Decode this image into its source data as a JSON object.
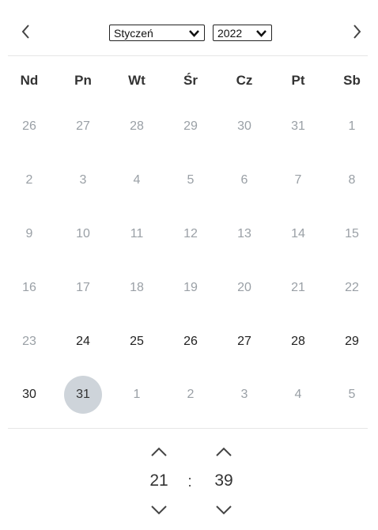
{
  "header": {
    "prev_icon": "chevron-left-icon",
    "next_icon": "chevron-right-icon",
    "month": "Styczeń",
    "year": "2022"
  },
  "weekdays": [
    "Nd",
    "Pn",
    "Wt",
    "Śr",
    "Cz",
    "Pt",
    "Sb"
  ],
  "weeks": [
    [
      {
        "d": "26",
        "m": true
      },
      {
        "d": "27",
        "m": true
      },
      {
        "d": "28",
        "m": true
      },
      {
        "d": "29",
        "m": true
      },
      {
        "d": "30",
        "m": true
      },
      {
        "d": "31",
        "m": true
      },
      {
        "d": "1",
        "m": true
      }
    ],
    [
      {
        "d": "2",
        "m": true
      },
      {
        "d": "3",
        "m": true
      },
      {
        "d": "4",
        "m": true
      },
      {
        "d": "5",
        "m": true
      },
      {
        "d": "6",
        "m": true
      },
      {
        "d": "7",
        "m": true
      },
      {
        "d": "8",
        "m": true
      }
    ],
    [
      {
        "d": "9",
        "m": true
      },
      {
        "d": "10",
        "m": true
      },
      {
        "d": "11",
        "m": true
      },
      {
        "d": "12",
        "m": true
      },
      {
        "d": "13",
        "m": true
      },
      {
        "d": "14",
        "m": true
      },
      {
        "d": "15",
        "m": true
      }
    ],
    [
      {
        "d": "16",
        "m": true
      },
      {
        "d": "17",
        "m": true
      },
      {
        "d": "18",
        "m": true
      },
      {
        "d": "19",
        "m": true
      },
      {
        "d": "20",
        "m": true
      },
      {
        "d": "21",
        "m": true
      },
      {
        "d": "22",
        "m": true
      }
    ],
    [
      {
        "d": "23",
        "m": true
      },
      {
        "d": "24",
        "m": false
      },
      {
        "d": "25",
        "m": false
      },
      {
        "d": "26",
        "m": false
      },
      {
        "d": "27",
        "m": false
      },
      {
        "d": "28",
        "m": false
      },
      {
        "d": "29",
        "m": false
      }
    ],
    [
      {
        "d": "30",
        "m": false
      },
      {
        "d": "31",
        "m": false,
        "selected": true
      },
      {
        "d": "1",
        "m": true
      },
      {
        "d": "2",
        "m": true
      },
      {
        "d": "3",
        "m": true
      },
      {
        "d": "4",
        "m": true
      },
      {
        "d": "5",
        "m": true
      }
    ]
  ],
  "time": {
    "hour": "21",
    "minute": "39",
    "separator": ":"
  },
  "colors": {
    "selected_bg": "#ced4da",
    "muted_text": "#9aa0a6",
    "divider": "#e6e6e6"
  }
}
